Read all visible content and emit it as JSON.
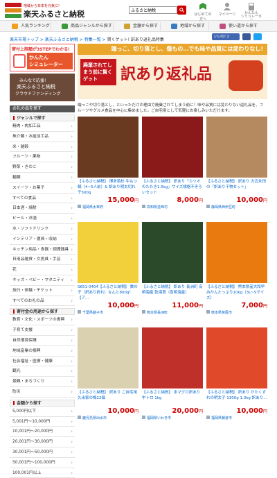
{
  "header": {
    "tagline": "地域から日本を元気に!",
    "site_name": "楽天ふるさと納税",
    "search_value": "ふるさと納税",
    "icons": [
      {
        "label": "はじめての方へ",
        "icon": "beginner-icon"
      },
      {
        "label": "マイページ",
        "icon": "person-icon"
      },
      {
        "label": "かんたん\nシミュレーター",
        "icon": "calculator-icon"
      }
    ]
  },
  "nav": {
    "items": [
      {
        "label": "人気ランキング",
        "color": "#f0a020"
      },
      {
        "label": "商品ジャンルから探す",
        "color": "#3a9a3a"
      },
      {
        "label": "金額から探す",
        "color": "#d0a030"
      },
      {
        "label": "地域から探す",
        "color": "#3a7ac0"
      },
      {
        "label": "使い道から探す",
        "color": "#c05080"
      }
    ]
  },
  "breadcrumb": {
    "items": [
      "楽天市場トップ",
      "楽天ふるさと納税",
      "特集一覧"
    ],
    "current": "賢くゲット! 訳あり返礼品特集"
  },
  "social": {
    "like_label": "いいね! 2"
  },
  "side": {
    "promo1_title": "寄付上限額が3STEPでわかる!",
    "promo1_body": "かんたん\nシミュレーター",
    "promo2_line1": "みんなで応援!",
    "promo2_line2": "楽天ふるさと納税",
    "promo2_line3": "クラウドファンディング",
    "section_title": "お礼の品を探す",
    "genre_title": "ジャンルで探す",
    "genres": [
      "精肉・肉加工品",
      "魚介類・水産加工品",
      "米・雑穀",
      "フルーツ・果物",
      "野菜・きのこ",
      "麺類",
      "スイーツ・お菓子",
      "すべての食品",
      "日本酒・焼酎",
      "ビール・洋酒",
      "水・ソフトドリンク",
      "インテリア・寝具・収納",
      "キッチン用品・食器・調理器具",
      "日用品雑貨・文房具・手芸",
      "花",
      "キッズ・ベビー・マタニティ",
      "旅行・体験・チケット",
      "すべてのお礼の品"
    ],
    "use_title": "寄付金の用途から探す",
    "uses": [
      "教育・文化・スポーツの振興",
      "子育て支援",
      "自然環境保護",
      "地域産業の振興",
      "社会福祉・医療・健康",
      "観光",
      "景観・まちづくり",
      "防災"
    ],
    "amount_title": "金額から探す",
    "amounts": [
      "5,000円以下",
      "5,001円〜10,000円",
      "10,001円〜20,000円",
      "20,001円〜30,000円",
      "30,001円〜50,000円",
      "50,001円〜100,000円",
      "100,001円以上"
    ]
  },
  "banner": {
    "top_text": "端っこ、切り落とし、傷もの…でも味や品質には変わりなし!",
    "red_box": "廃棄されてしまう前に賢くゲット",
    "title": "訳あり返礼品"
  },
  "description": "端っこや切り落とし、といっただけの理由で廃棄されてしまう前に！味や品質には変わりない返礼品を、フルーツやグルメ食品を中心に集めました。ご自宅用として気軽にお楽しみいただけます。",
  "products": [
    {
      "title": "【ふるさと納税】 博多若杉 牛もつ鍋（4~5人前）& 訳あり明太切れ子500g",
      "price": "15,000",
      "loc": "福岡県太宰府",
      "bg": "#6a3a20"
    },
    {
      "title": "【ふるさと納税】 訳あり「カツオのたたき1.5kg」サイズ規格不ぞろいセット",
      "price": "8,000",
      "loc": "高知県芸西村",
      "bg": "#8a1a1a"
    },
    {
      "title": "【ふるさと納税】 訳あり 大辺永田の「訳あり干物セット」",
      "price": "10,000",
      "loc": "静岡県西伊豆町",
      "bg": "#b58a60"
    },
    {
      "title": "S651-0404【ふるさと納税】 数の子（訳あり折れ）なんと800g！【ア…",
      "price": "10,000",
      "loc": "千葉県銚子市",
      "bg": "#f2d03c"
    },
    {
      "title": "【ふるさと納税】 訳あり 長洲町 有明海産 乾海苔（有明海産）",
      "price": "11,000",
      "loc": "熊本県長洲町",
      "bg": "#2a4a2a"
    },
    {
      "title": "【ふるさと納税】 熊本県産大和早みかんたっぷり10kg（3L~Sサイズ）",
      "price": "7,000",
      "loc": "熊本県荒尾市",
      "bg": "#e87a10"
    },
    {
      "title": "【ふるさと納税】 訳あり ご自宅用 久米家の梅22個",
      "price": "10,000",
      "loc": "鹿児島県出水市",
      "bg": "#d9d1b0"
    },
    {
      "title": "【ふるさと納税】 本マグロ訳あり中トロ 1kg",
      "price": "20,000",
      "loc": "福岡県いわき市",
      "bg": "#c0302a"
    },
    {
      "title": "【ふるさと納税】 訳あり かたくずれの明太子 1300g 1.3kg 訳あり…",
      "price": "10,000",
      "loc": "福岡県朝倉市",
      "bg": "#e04a2a"
    }
  ],
  "price_suffix": "円"
}
